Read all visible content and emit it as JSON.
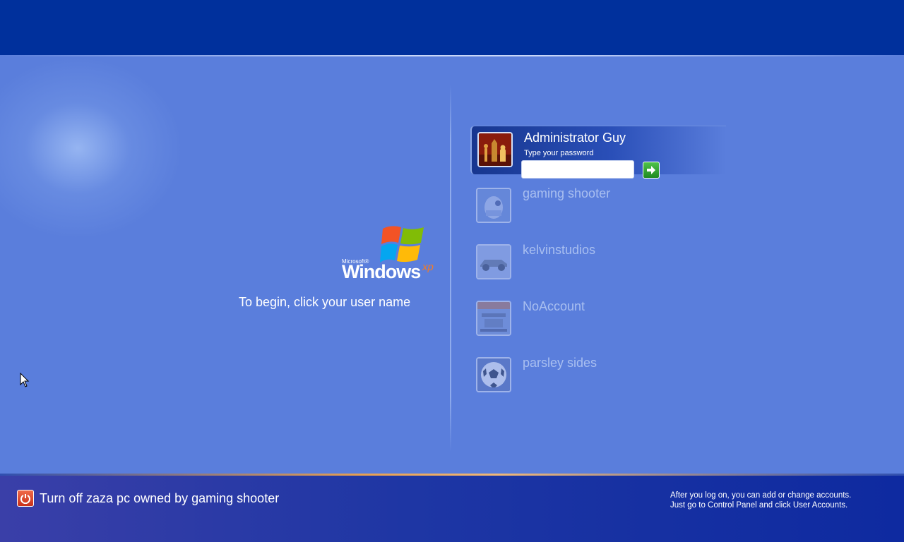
{
  "logo": {
    "microsoft": "Microsoft®",
    "windows": "Windows",
    "xp": "xp"
  },
  "prompt": "To begin, click your user name",
  "users": [
    {
      "name": "Administrator Guy",
      "hint": "Type your password",
      "password": "",
      "avatar": "chess-pieces",
      "selected": true
    },
    {
      "name": "gaming shooter",
      "avatar": "robot",
      "selected": false
    },
    {
      "name": "kelvinstudios",
      "avatar": "race-car",
      "selected": false
    },
    {
      "name": "NoAccount",
      "avatar": "airplane",
      "selected": false
    },
    {
      "name": "parsley sides",
      "avatar": "soccer-ball",
      "selected": false
    }
  ],
  "footer": {
    "turn_off": "Turn off zaza pc owned by gaming shooter",
    "info_line1": "After you log on, you can add or change accounts.",
    "info_line2": "Just go to Control Panel and click User Accounts."
  },
  "colors": {
    "background": "#5a7edc",
    "top_band": "#00309c",
    "bottom_band": "#1e36a4",
    "accent_orange": "#e8a050",
    "logo_xp": "#f07a2a"
  }
}
